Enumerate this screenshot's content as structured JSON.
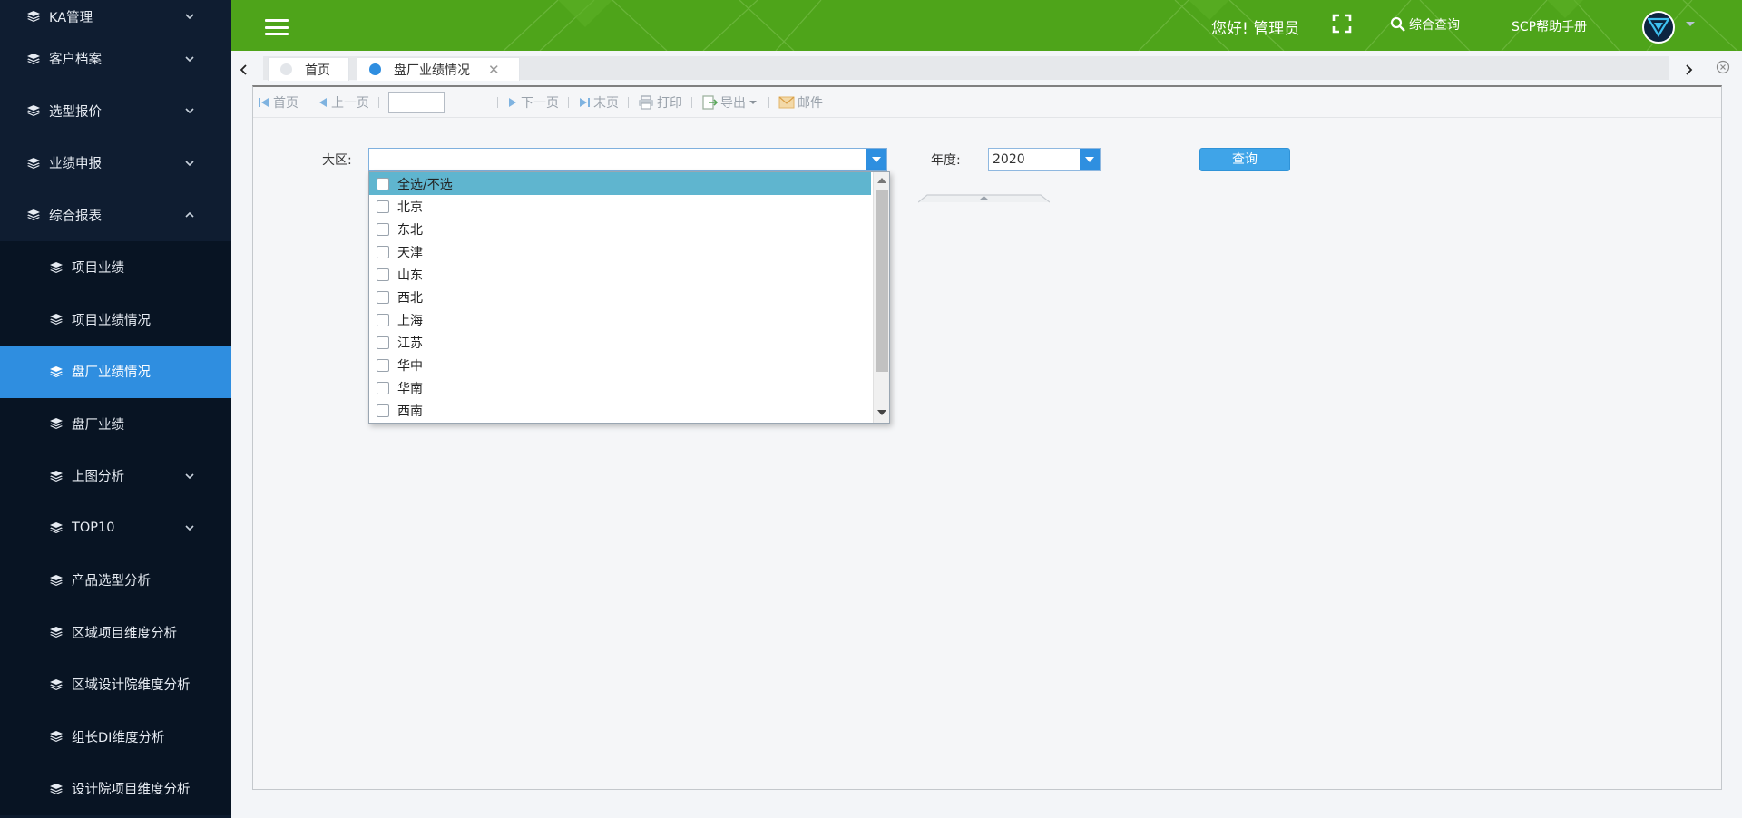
{
  "sidebar": {
    "items": [
      {
        "label": "KA管理",
        "expandable": true,
        "expanded": false
      },
      {
        "label": "客户档案",
        "expandable": true,
        "expanded": false
      },
      {
        "label": "选型报价",
        "expandable": true,
        "expanded": false
      },
      {
        "label": "业绩申报",
        "expandable": true,
        "expanded": false
      },
      {
        "label": "综合报表",
        "expandable": true,
        "expanded": true
      }
    ],
    "subitems": [
      {
        "label": "项目业绩"
      },
      {
        "label": "项目业绩情况"
      },
      {
        "label": "盘厂业绩情况",
        "active": true
      },
      {
        "label": "盘厂业绩"
      },
      {
        "label": "上图分析",
        "expandable": true
      },
      {
        "label": "TOP10",
        "expandable": true
      },
      {
        "label": "产品选型分析"
      },
      {
        "label": "区域项目维度分析"
      },
      {
        "label": "区域设计院维度分析"
      },
      {
        "label": "组长DI维度分析"
      },
      {
        "label": "设计院项目维度分析"
      }
    ]
  },
  "header": {
    "greeting": "您好! 管理员",
    "search_label": "综合查询",
    "help_label": "SCP帮助手册",
    "icons": [
      "menu-icon",
      "fullscreen-icon",
      "search-icon",
      "avatar-logo-icon"
    ]
  },
  "tabs": [
    {
      "label": "首页",
      "active": false
    },
    {
      "label": "盘厂业绩情况",
      "active": true,
      "closable": true
    }
  ],
  "toolbar": {
    "first": "首页",
    "prev": "上一页",
    "page_value": "",
    "next": "下一页",
    "last": "末页",
    "print": "打印",
    "export": "导出",
    "mail": "邮件"
  },
  "filters": {
    "region_label": "大区:",
    "region_value": "",
    "year_label": "年度:",
    "year_value": "2020",
    "query_button": "查询"
  },
  "region_dropdown": {
    "options": [
      "全选/不选",
      "北京",
      "东北",
      "天津",
      "山东",
      "西北",
      "上海",
      "江苏",
      "华中",
      "华南",
      "西南"
    ],
    "highlighted": "全选/不选"
  },
  "colors": {
    "header_green": "#4ea41a",
    "sidebar_bg": "#0d1b2e",
    "active_blue": "#2f8ee0",
    "query_button": "#3fa4e8",
    "highlight_row": "#5fb5cf"
  }
}
